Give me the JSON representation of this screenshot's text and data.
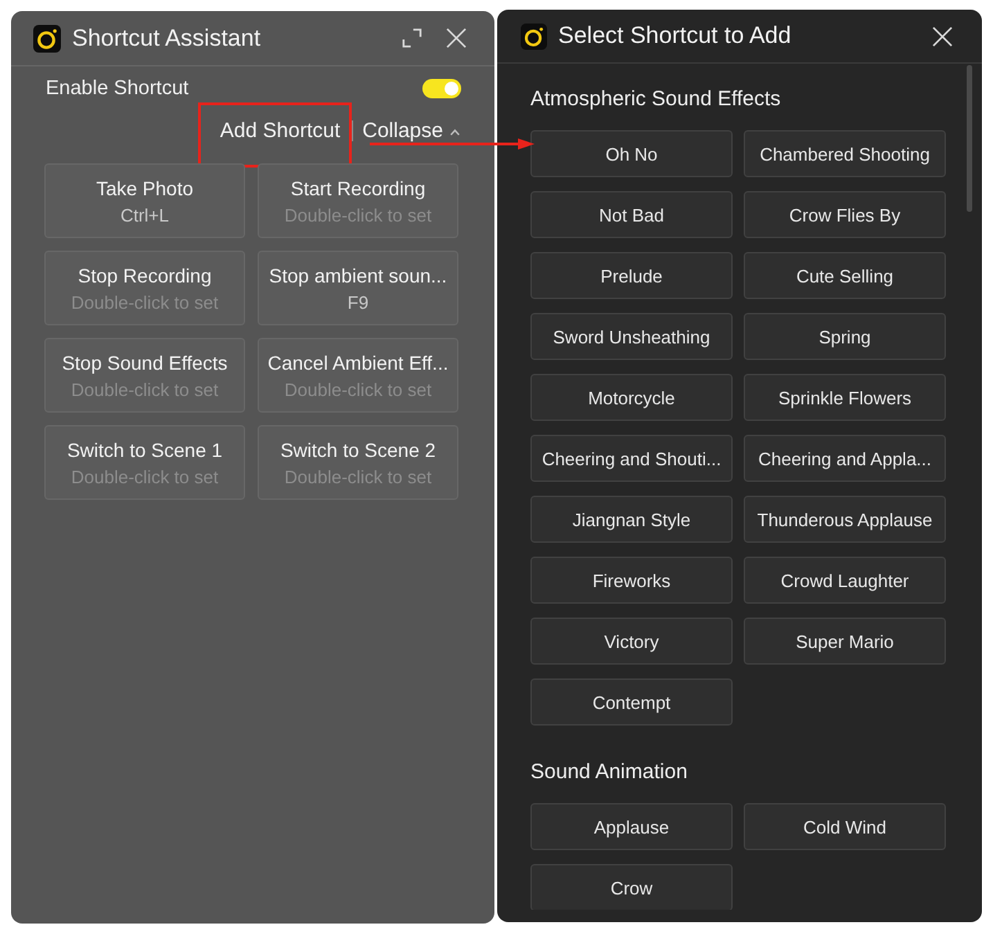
{
  "shortcut_window": {
    "title": "Shortcut Assistant",
    "enable": {
      "label": "Enable Shortcut",
      "on": true
    },
    "actions": {
      "add_shortcut": {
        "label": "Add Shortcut",
        "highlighted": true
      },
      "collapse": {
        "label": "Collapse"
      }
    },
    "shortcuts": [
      {
        "name": "Take Photo",
        "key": "Ctrl+L",
        "assigned": true
      },
      {
        "name": "Start Recording",
        "key": "Double-click to set",
        "assigned": false
      },
      {
        "name": "Stop Recording",
        "key": "Double-click to set",
        "assigned": false
      },
      {
        "name": "Stop ambient soun...",
        "key": "F9",
        "assigned": true
      },
      {
        "name": "Stop Sound Effects",
        "key": "Double-click to set",
        "assigned": false
      },
      {
        "name": "Cancel Ambient Eff...",
        "key": "Double-click to set",
        "assigned": false
      },
      {
        "name": "Switch to Scene 1",
        "key": "Double-click to set",
        "assigned": false
      },
      {
        "name": "Switch to Scene 2",
        "key": "Double-click to set",
        "assigned": false
      }
    ]
  },
  "picker_window": {
    "title": "Select Shortcut to Add",
    "sections": [
      {
        "title": "Atmospheric Sound Effects",
        "items": [
          "Oh No",
          "Chambered Shooting",
          "Not Bad",
          "Crow Flies By",
          "Prelude",
          "Cute Selling",
          "Sword Unsheathing",
          "Spring",
          "Motorcycle",
          "Sprinkle Flowers",
          "Cheering and Shouti...",
          "Cheering and Appla...",
          "Jiangnan Style",
          "Thunderous Applause",
          "Fireworks",
          "Crowd Laughter",
          "Victory",
          "Super Mario",
          "Contempt"
        ]
      },
      {
        "title": "Sound Animation",
        "items": [
          "Applause",
          "Cold Wind",
          "Crow"
        ]
      }
    ]
  }
}
